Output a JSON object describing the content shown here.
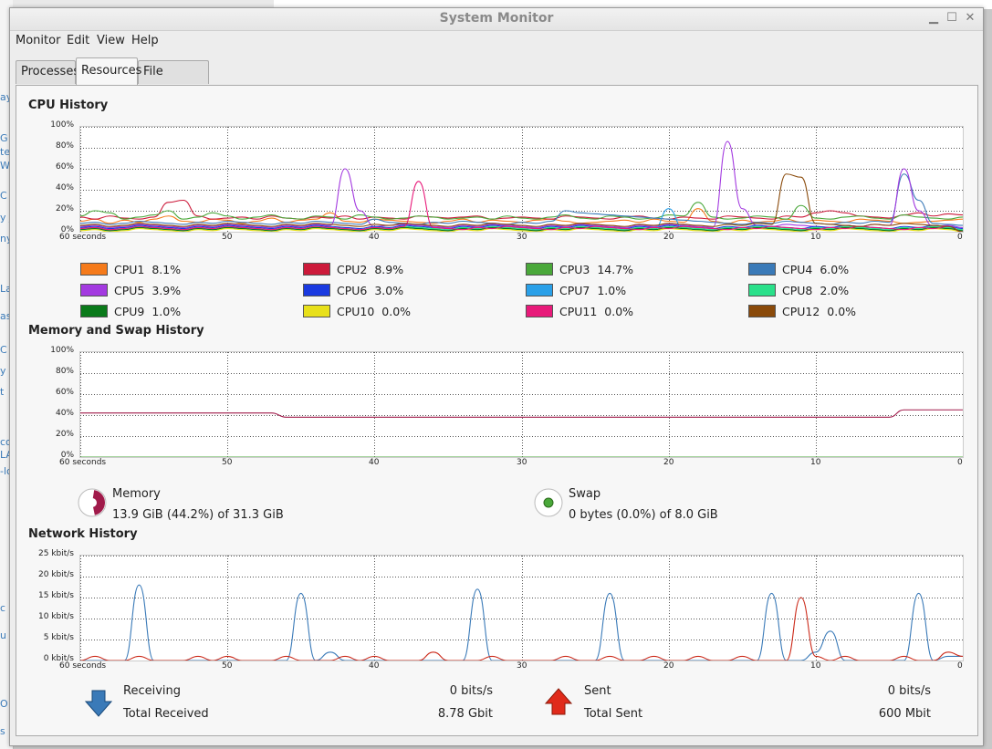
{
  "window": {
    "title": "System Monitor"
  },
  "menubar": [
    "Monitor",
    "Edit",
    "View",
    "Help"
  ],
  "tabs": [
    "Processes",
    "Resources",
    "File Systems"
  ],
  "active_tab": "Resources",
  "axis": {
    "pct_ticks": [
      "100%",
      "80%",
      "60%",
      "40%",
      "20%",
      "0%"
    ],
    "x_ticks": [
      "60 seconds",
      "50",
      "40",
      "30",
      "20",
      "10",
      "0"
    ],
    "net_ticks": [
      "25 kbit/s",
      "20 kbit/s",
      "15 kbit/s",
      "10 kbit/s",
      "5 kbit/s",
      "0 kbit/s"
    ]
  },
  "cpu": {
    "title": "CPU History",
    "series": [
      {
        "name": "CPU1",
        "value": "8.1%",
        "color": "#f57a1a",
        "values": [
          10,
          12,
          8,
          11,
          9,
          12,
          15,
          10,
          9,
          12,
          11,
          8,
          10,
          13,
          9,
          11,
          12,
          18,
          10,
          9,
          12,
          11,
          10,
          9,
          8,
          10,
          12,
          9,
          11,
          10,
          9,
          11,
          12,
          10,
          8,
          9,
          10,
          11,
          9,
          12,
          10,
          9,
          22,
          10,
          8,
          11,
          9,
          10,
          12,
          9,
          11,
          10,
          9,
          12,
          11,
          10,
          8,
          9,
          10,
          11,
          12
        ]
      },
      {
        "name": "CPU2",
        "value": "8.9%",
        "color": "#cc1a3a",
        "values": [
          14,
          12,
          15,
          13,
          12,
          14,
          28,
          30,
          15,
          12,
          13,
          14,
          12,
          15,
          13,
          12,
          14,
          13,
          15,
          12,
          14,
          13,
          12,
          15,
          14,
          13,
          14,
          15,
          12,
          13,
          14,
          13,
          12,
          15,
          14,
          13,
          12,
          14,
          15,
          13,
          12,
          14,
          13,
          12,
          15,
          14,
          13,
          12,
          15,
          14,
          18,
          20,
          18,
          15,
          14,
          13,
          16,
          18,
          15,
          17,
          16
        ]
      },
      {
        "name": "CPU3",
        "value": "14.7%",
        "color": "#4aa83a",
        "values": [
          15,
          20,
          18,
          12,
          14,
          16,
          20,
          12,
          14,
          18,
          15,
          12,
          14,
          16,
          13,
          12,
          15,
          14,
          12,
          16,
          14,
          12,
          13,
          15,
          14,
          12,
          13,
          14,
          12,
          15,
          13,
          12,
          14,
          16,
          13,
          12,
          15,
          14,
          12,
          13,
          16,
          15,
          28,
          14,
          12,
          13,
          15,
          14,
          12,
          25,
          13,
          12,
          14,
          15,
          13,
          12,
          16,
          14,
          13,
          12,
          14
        ]
      },
      {
        "name": "CPU4",
        "value": "6.0%",
        "color": "#3a7ab8",
        "values": [
          8,
          9,
          7,
          8,
          10,
          9,
          8,
          7,
          9,
          8,
          10,
          9,
          8,
          7,
          9,
          8,
          10,
          9,
          8,
          7,
          12,
          9,
          8,
          7,
          9,
          8,
          10,
          9,
          8,
          7,
          9,
          8,
          10,
          20,
          18,
          17,
          16,
          15,
          14,
          13,
          12,
          11,
          10,
          9,
          8,
          7,
          9,
          8,
          10,
          9,
          8,
          7,
          9,
          8,
          10,
          9,
          55,
          30,
          8,
          7,
          6
        ]
      },
      {
        "name": "CPU5",
        "value": "3.9%",
        "color": "#a33ae0",
        "values": [
          5,
          6,
          4,
          5,
          7,
          6,
          5,
          4,
          6,
          5,
          7,
          6,
          5,
          4,
          6,
          5,
          7,
          6,
          60,
          20,
          5,
          6,
          7,
          6,
          5,
          4,
          6,
          5,
          7,
          6,
          5,
          4,
          6,
          5,
          7,
          6,
          5,
          4,
          6,
          5,
          7,
          6,
          5,
          4,
          86,
          22,
          6,
          5,
          7,
          6,
          5,
          4,
          6,
          5,
          7,
          6,
          60,
          20,
          5,
          6,
          4
        ]
      },
      {
        "name": "CPU6",
        "value": "3.0%",
        "color": "#1a3ae0",
        "values": [
          4,
          5,
          3,
          4,
          6,
          5,
          4,
          3,
          5,
          4,
          6,
          5,
          4,
          3,
          5,
          4,
          6,
          5,
          4,
          3,
          5,
          4,
          6,
          5,
          4,
          3,
          5,
          4,
          6,
          5,
          4,
          3,
          5,
          4,
          6,
          5,
          4,
          3,
          5,
          4,
          6,
          5,
          4,
          3,
          5,
          4,
          6,
          5,
          4,
          3,
          5,
          4,
          6,
          5,
          4,
          3,
          5,
          4,
          6,
          5,
          3
        ]
      },
      {
        "name": "CPU7",
        "value": "1.0%",
        "color": "#2aa0e8",
        "values": [
          2,
          3,
          1,
          2,
          4,
          3,
          2,
          1,
          3,
          2,
          4,
          3,
          2,
          1,
          3,
          2,
          4,
          3,
          2,
          1,
          3,
          2,
          4,
          3,
          2,
          1,
          3,
          2,
          4,
          3,
          2,
          1,
          3,
          2,
          4,
          3,
          2,
          1,
          3,
          2,
          22,
          3,
          2,
          1,
          3,
          2,
          4,
          3,
          2,
          1,
          3,
          2,
          4,
          3,
          2,
          1,
          3,
          2,
          4,
          3,
          1
        ]
      },
      {
        "name": "CPU8",
        "value": "2.0%",
        "color": "#2ae08a",
        "values": [
          3,
          4,
          2,
          3,
          5,
          4,
          3,
          2,
          4,
          3,
          5,
          4,
          3,
          2,
          4,
          3,
          5,
          4,
          3,
          2,
          4,
          3,
          5,
          4,
          3,
          2,
          4,
          3,
          5,
          4,
          3,
          2,
          4,
          3,
          5,
          4,
          3,
          2,
          4,
          3,
          5,
          4,
          3,
          2,
          4,
          3,
          5,
          4,
          3,
          2,
          4,
          3,
          5,
          4,
          3,
          2,
          4,
          3,
          5,
          4,
          2
        ]
      },
      {
        "name": "CPU9",
        "value": "1.0%",
        "color": "#0a7a1a",
        "values": [
          2,
          3,
          1,
          2,
          4,
          3,
          2,
          1,
          3,
          2,
          4,
          3,
          2,
          1,
          3,
          2,
          4,
          3,
          2,
          1,
          3,
          2,
          4,
          3,
          2,
          1,
          3,
          2,
          4,
          3,
          2,
          1,
          3,
          2,
          4,
          3,
          2,
          1,
          3,
          2,
          4,
          3,
          2,
          1,
          3,
          2,
          4,
          3,
          2,
          1,
          3,
          2,
          4,
          3,
          2,
          1,
          3,
          2,
          4,
          3,
          1
        ]
      },
      {
        "name": "CPU10",
        "value": "0.0%",
        "color": "#e8e01a",
        "values": [
          1,
          2,
          0,
          1,
          3,
          2,
          1,
          0,
          2,
          1,
          3,
          2,
          1,
          0,
          2,
          1,
          3,
          2,
          1,
          0,
          2,
          1,
          3,
          2,
          1,
          0,
          2,
          1,
          3,
          2,
          1,
          0,
          2,
          1,
          3,
          2,
          1,
          0,
          2,
          1,
          3,
          2,
          1,
          0,
          2,
          1,
          3,
          2,
          1,
          0,
          2,
          1,
          3,
          2,
          1,
          0,
          2,
          1,
          3,
          2,
          0
        ]
      },
      {
        "name": "CPU11",
        "value": "0.0%",
        "color": "#e81a7a",
        "values": [
          3,
          4,
          2,
          3,
          5,
          4,
          3,
          2,
          4,
          3,
          5,
          4,
          3,
          2,
          4,
          3,
          5,
          4,
          3,
          2,
          4,
          3,
          5,
          48,
          4,
          3,
          2,
          4,
          3,
          5,
          4,
          3,
          2,
          4,
          3,
          5,
          4,
          3,
          2,
          4,
          3,
          5,
          4,
          3,
          2,
          4,
          3,
          5,
          4,
          3,
          2,
          4,
          3,
          5,
          4,
          3,
          2,
          4,
          3,
          5,
          0
        ]
      },
      {
        "name": "CPU12",
        "value": "0.0%",
        "color": "#8a4a0a",
        "values": [
          6,
          7,
          5,
          6,
          8,
          7,
          6,
          5,
          7,
          6,
          8,
          7,
          6,
          5,
          7,
          6,
          8,
          7,
          6,
          5,
          7,
          6,
          8,
          7,
          6,
          5,
          7,
          6,
          8,
          7,
          6,
          5,
          7,
          6,
          8,
          7,
          6,
          5,
          7,
          6,
          8,
          7,
          6,
          5,
          7,
          6,
          8,
          7,
          55,
          52,
          8,
          7,
          6,
          5,
          7,
          6,
          8,
          7,
          6,
          5,
          0
        ]
      }
    ]
  },
  "memory": {
    "title": "Memory and Swap History",
    "mem_series": {
      "color": "#a01a4a",
      "values": [
        42,
        42,
        42,
        42,
        42,
        42,
        42,
        42,
        42,
        42,
        42,
        42,
        42,
        42,
        38,
        38,
        38,
        38,
        38,
        38,
        38,
        38,
        38,
        38,
        38,
        38,
        38,
        38,
        38,
        38,
        38,
        38,
        38,
        38,
        38,
        38,
        38,
        38,
        38,
        38,
        38,
        38,
        38,
        38,
        38,
        38,
        38,
        38,
        38,
        38,
        38,
        38,
        38,
        38,
        38,
        38,
        45,
        45,
        45,
        45,
        45
      ]
    },
    "swap_series": {
      "color": "#4aa83a",
      "values": [
        0,
        0,
        0,
        0,
        0,
        0,
        0,
        0,
        0,
        0,
        0,
        0,
        0,
        0,
        0,
        0,
        0,
        0,
        0,
        0,
        0,
        0,
        0,
        0,
        0,
        0,
        0,
        0,
        0,
        0,
        0,
        0,
        0,
        0,
        0,
        0,
        0,
        0,
        0,
        0,
        0,
        0,
        0,
        0,
        0,
        0,
        0,
        0,
        0,
        0,
        0,
        0,
        0,
        0,
        0,
        0,
        0,
        0,
        0,
        0,
        0
      ]
    },
    "mem_label": "Memory",
    "mem_value": "13.9 GiB (44.2%) of 31.3 GiB",
    "mem_fraction": 0.442,
    "swap_label": "Swap",
    "swap_value": "0 bytes (0.0%) of 8.0 GiB",
    "swap_fraction": 0.0
  },
  "network": {
    "title": "Network History",
    "recv_series": {
      "color": "#3a7ab8",
      "values": [
        0,
        0,
        0,
        0,
        18,
        0,
        0,
        0,
        0,
        0,
        0,
        0,
        0,
        0,
        0,
        16,
        0,
        2,
        0,
        0,
        0,
        0,
        0,
        0,
        0,
        0,
        0,
        17,
        0,
        0,
        0,
        0,
        0,
        0,
        0,
        0,
        16,
        0,
        0,
        0,
        0,
        0,
        0,
        0,
        0,
        0,
        0,
        16,
        0,
        0,
        2,
        7,
        0,
        0,
        0,
        0,
        0,
        16,
        0,
        1,
        1
      ]
    },
    "sent_series": {
      "color": "#cc2a1a",
      "values": [
        0,
        1,
        0,
        0,
        1,
        0,
        0,
        0,
        1,
        0,
        1,
        0,
        0,
        0,
        1,
        0,
        0,
        0,
        1,
        0,
        1,
        0,
        0,
        0,
        2,
        0,
        0,
        0,
        1,
        0,
        0,
        0,
        0,
        1,
        0,
        0,
        1,
        0,
        0,
        1,
        0,
        0,
        1,
        0,
        0,
        1,
        0,
        0,
        0,
        15,
        1,
        0,
        1,
        0,
        0,
        0,
        1,
        0,
        0,
        2,
        1
      ]
    },
    "receiving_label": "Receiving",
    "receiving_value": "0 bits/s",
    "total_received_label": "Total Received",
    "total_received_value": "8.78 Gbit",
    "sent_label": "Sent",
    "sent_value": "0 bits/s",
    "total_sent_label": "Total Sent",
    "total_sent_value": "600 Mbit"
  },
  "background_fragments": [
    "ay",
    "G",
    "te",
    "W",
    "C",
    "y j",
    "ny",
    "La",
    "as",
    "C",
    "y s",
    "t",
    "co",
    "LA",
    "-lo",
    "c a",
    "u",
    "O",
    "s b"
  ]
}
